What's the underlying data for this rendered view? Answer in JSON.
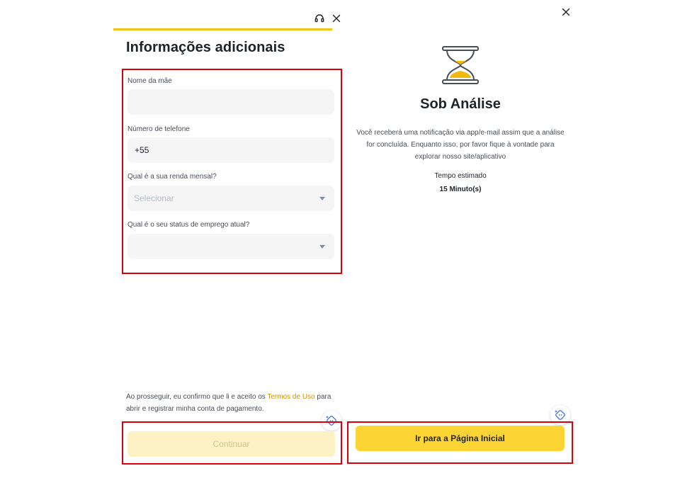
{
  "form": {
    "title": "Informações adicionais",
    "progress_fraction": 1.0,
    "accent_color": "#F0C419",
    "fields": {
      "mother_name": {
        "label": "Nome da mãe",
        "value": ""
      },
      "phone": {
        "label": "Número de telefone",
        "value": "+55"
      },
      "income": {
        "label": "Qual é a sua renda mensal?",
        "placeholder": "Selecionar"
      },
      "employment": {
        "label": "Qual é o seu status de emprego atual?",
        "placeholder": ""
      }
    },
    "terms": {
      "prefix": "Ao prosseguir, eu confirmo que li e aceito os ",
      "link": "Termos de Uso",
      "suffix": " para abrir e registrar minha conta de pagamento."
    },
    "continue_label": "Continuar"
  },
  "review": {
    "title": "Sob Análise",
    "description": "Você receberá uma notificação via app/e-mail assim que a análise for concluída. Enquanto isso, por favor fique à vontade para explorar nosso site/aplicativo",
    "estimate_label": "Tempo estimado",
    "estimate_value": "15 Minuto(s)",
    "home_button_label": "Ir para a Página Inicial"
  },
  "icons": {
    "support": "headset-icon",
    "close": "close-icon",
    "status": "hourglass-icon",
    "helper": "magic-helper-icon",
    "dropdown": "chevron-down-icon"
  },
  "colors": {
    "primary_button": "#FCD535",
    "disabled_button": "#FCF2C3",
    "highlight_box": "#D9000D",
    "link": "#C99400"
  }
}
